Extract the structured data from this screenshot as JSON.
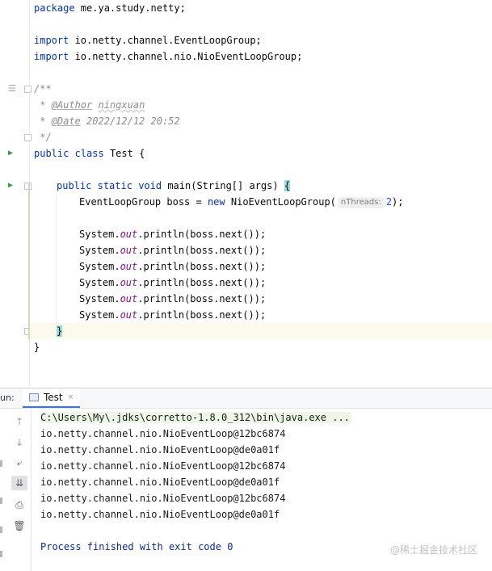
{
  "editor": {
    "lines": {
      "package_kw": "package",
      "package_name": " me.ya.study.netty;",
      "import_kw": "import",
      "import1": " io.netty.channel.EventLoopGroup;",
      "import2": " io.netty.channel.nio.NioEventLoopGroup;",
      "doc_open": "/**",
      "doc_star": " * ",
      "author_tag": "@Author",
      "author_value": "ningxuan",
      "date_tag": "@Date",
      "date_value": " 2022/12/12 20:52",
      "doc_close": " */",
      "class_kw1": "public",
      "class_kw2": "class",
      "class_name": " Test {",
      "main_kw1": "public",
      "main_kw2": "static",
      "main_kw3": "void",
      "main_sig": " main(String[] args) ",
      "open_brace": "{",
      "group_prefix": "EventLoopGroup boss = ",
      "new_kw": "new",
      "group_ctor": " NioEventLoopGroup(",
      "param_hint": "nThreads:",
      "thread_count": "2",
      "group_suffix": ");",
      "println_prefix": "System.",
      "out_field": "out",
      "println_suffix": ".println(boss.next());",
      "close_method": "}",
      "close_class": "}"
    }
  },
  "run_panel": {
    "label": "un:",
    "tab_label": "Test",
    "tab_close": "×",
    "tools": [
      "up-arrow-icon",
      "down-arrow-icon",
      "soft-wrap-icon",
      "scroll-to-end-icon",
      "print-icon",
      "trash-icon"
    ],
    "console": {
      "command": "C:\\Users\\My\\.jdks\\corretto-1.8.0_312\\bin\\java.exe ...",
      "outputs": [
        "io.netty.channel.nio.NioEventLoop@12bc6874",
        "io.netty.channel.nio.NioEventLoop@de0a01f",
        "io.netty.channel.nio.NioEventLoop@12bc6874",
        "io.netty.channel.nio.NioEventLoop@de0a01f",
        "io.netty.channel.nio.NioEventLoop@12bc6874",
        "io.netty.channel.nio.NioEventLoop@de0a01f"
      ],
      "exit_message": "Process finished with exit code 0"
    },
    "watermark": "@稀土掘金技术社区"
  },
  "colors": {
    "keyword": "#0033b3",
    "comment": "#8c8c8c",
    "static_field": "#871094",
    "number": "#1750eb",
    "exit_text": "#0b2a96",
    "run_green": "#389e4a"
  }
}
